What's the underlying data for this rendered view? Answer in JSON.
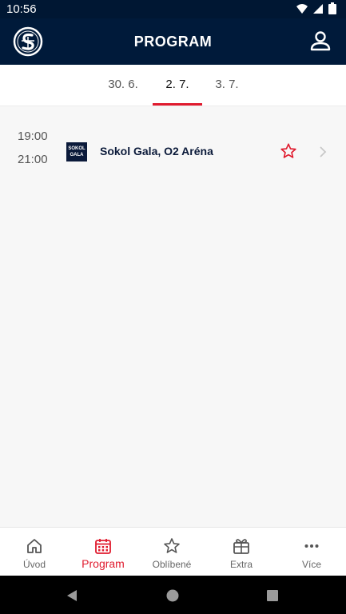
{
  "status_bar": {
    "time": "10:56"
  },
  "header": {
    "title": "PROGRAM"
  },
  "date_tabs": [
    {
      "label": "30. 6."
    },
    {
      "label": "2. 7."
    },
    {
      "label": "3. 7."
    }
  ],
  "events": [
    {
      "start": "19:00",
      "end": "21:00",
      "logo_text": "SOKOL GALA",
      "title": "Sokol Gala, O2 Aréna"
    }
  ],
  "bottom_nav": [
    {
      "label": "Úvod",
      "icon": "home-icon"
    },
    {
      "label": "Program",
      "icon": "calendar-icon"
    },
    {
      "label": "Oblíbené",
      "icon": "star-icon"
    },
    {
      "label": "Extra",
      "icon": "gift-icon"
    },
    {
      "label": "Více",
      "icon": "more-icon"
    }
  ],
  "colors": {
    "accent": "#e01b2e",
    "brand_navy": "#001a3a"
  }
}
